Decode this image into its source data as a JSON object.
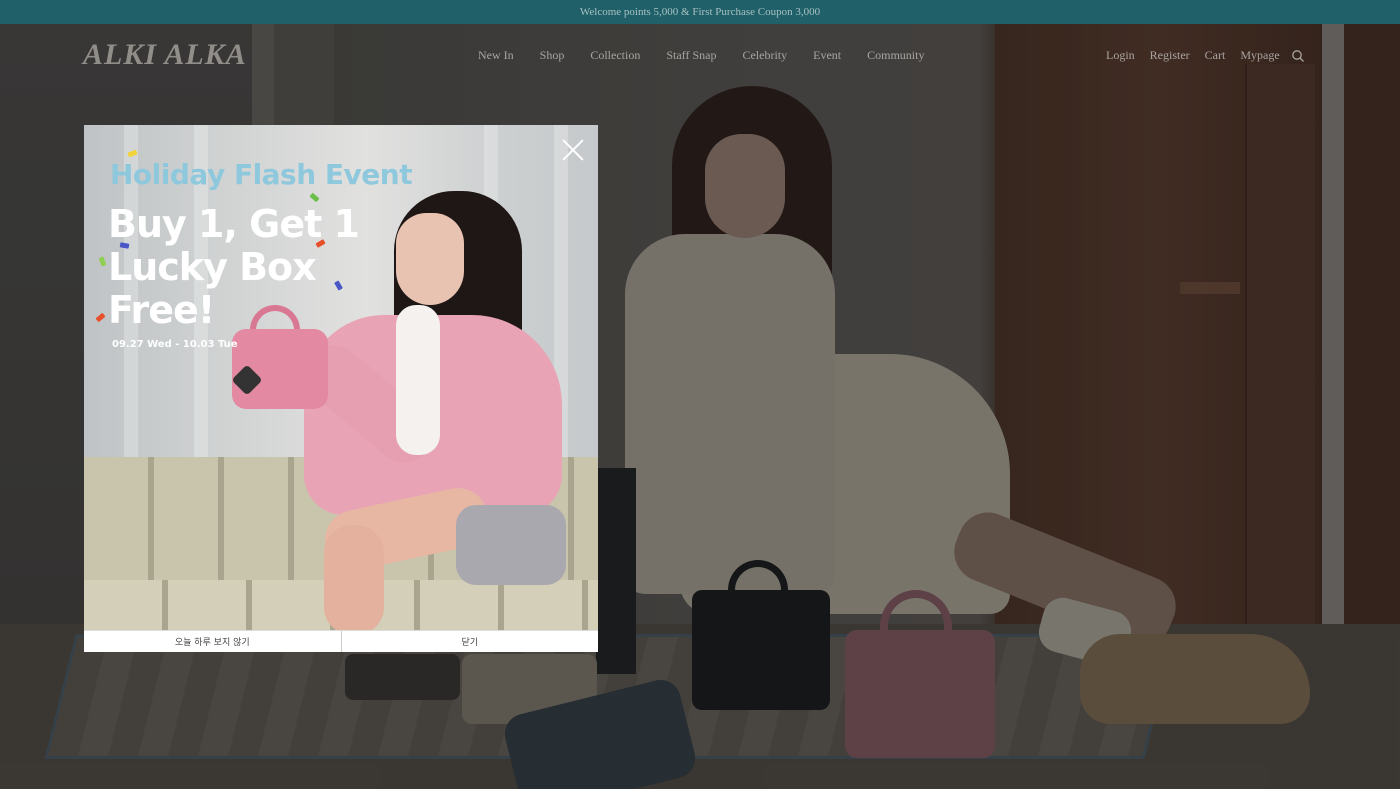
{
  "promo_bar": {
    "text": "Welcome points 5,000 & First Purchase Coupon 3,000"
  },
  "header": {
    "logo": "ALKI ALKA",
    "nav": [
      "New In",
      "Shop",
      "Collection",
      "Staff Snap",
      "Celebrity",
      "Event",
      "Community"
    ],
    "utility": [
      "Login",
      "Register",
      "Cart",
      "Mypage"
    ],
    "search_icon": "search-icon"
  },
  "popup": {
    "event_title": "Holiday Flash Event",
    "headline_line1": "Buy 1, Get 1",
    "headline_line2": "Lucky Box",
    "headline_line3": "Free!",
    "dates": "09.27 Wed - 10.03 Tue",
    "close_icon": "close-icon",
    "footer": {
      "hide_today": "오늘 하루 보지 않기",
      "close": "닫기"
    }
  },
  "colors": {
    "promo_bar": "#1f6069",
    "event_title": "#8ec8dd",
    "headline": "#ffffff"
  }
}
